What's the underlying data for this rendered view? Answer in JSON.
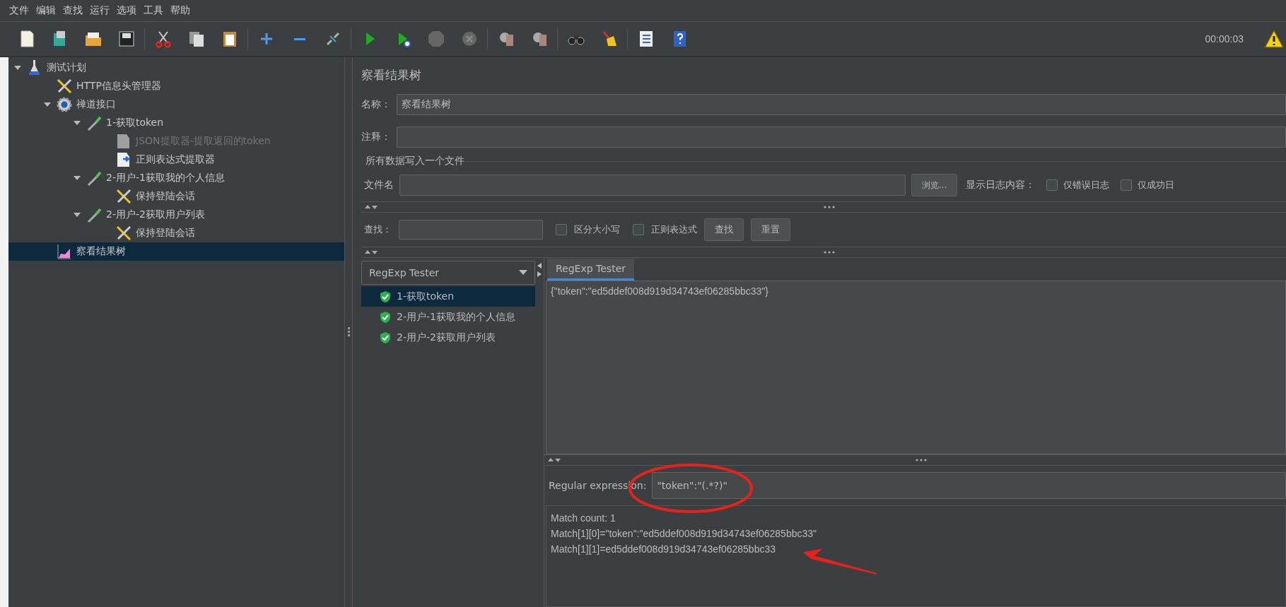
{
  "menu": [
    "文件",
    "编辑",
    "查找",
    "运行",
    "选项",
    "工具",
    "帮助"
  ],
  "toolbar": {
    "timer": "00:00:03"
  },
  "tree": [
    {
      "label": "测试计划",
      "kind": "plan",
      "expanded": true,
      "selected": false,
      "disabled": false,
      "children": [
        {
          "label": "HTTP信息头管理器",
          "kind": "config",
          "selected": false,
          "disabled": false
        },
        {
          "label": "禅道接口",
          "kind": "thread",
          "expanded": true,
          "selected": false,
          "disabled": false,
          "children": [
            {
              "label": "1-获取token",
              "kind": "sampler",
              "expanded": true,
              "selected": false,
              "disabled": false,
              "children": [
                {
                  "label": "JSON提取器-提取返回的token",
                  "kind": "extractor",
                  "selected": false,
                  "disabled": true
                },
                {
                  "label": "正则表达式提取器",
                  "kind": "extractor",
                  "selected": false,
                  "disabled": false
                }
              ]
            },
            {
              "label": "2-用户-1获取我的个人信息",
              "kind": "sampler",
              "expanded": true,
              "selected": false,
              "disabled": false,
              "children": [
                {
                  "label": "保持登陆会话",
                  "kind": "config",
                  "selected": false,
                  "disabled": false
                }
              ]
            },
            {
              "label": "2-用户-2获取用户列表",
              "kind": "sampler",
              "expanded": true,
              "selected": false,
              "disabled": false,
              "children": [
                {
                  "label": "保持登陆会话",
                  "kind": "config",
                  "selected": false,
                  "disabled": false
                }
              ]
            }
          ]
        },
        {
          "label": "察看结果树",
          "kind": "listener",
          "selected": true,
          "disabled": false
        }
      ]
    }
  ],
  "panel": {
    "title": "察看结果树",
    "name_field": {
      "label": "名称：",
      "value": "察看结果树"
    },
    "comment_field": {
      "label": "注释："
    },
    "file_section": {
      "legend": "所有数据写入一个文件",
      "file_label": "文件名",
      "browse_button": "浏览...",
      "log_label": "显示日志内容：",
      "checkboxes": [
        {
          "label": "仅错误日志",
          "checked": false
        },
        {
          "label": "仅成功日",
          "checked": false
        }
      ]
    },
    "search": {
      "label": "查找：",
      "checkboxes": [
        {
          "label": "区分大小写",
          "checked": false
        },
        {
          "label": "正则表达式",
          "checked": false
        }
      ],
      "buttons": [
        "查找",
        "重置"
      ]
    }
  },
  "results": {
    "renderer": "RegExp Tester",
    "samples": [
      {
        "label": "1-获取token",
        "selected": true
      },
      {
        "label": "2-用户-1获取我的个人信息",
        "selected": false
      },
      {
        "label": "2-用户-2获取用户列表",
        "selected": false
      }
    ],
    "tabs": [
      {
        "label": "RegExp Tester",
        "selected": true
      }
    ],
    "response": "{\"token\":\"ed5ddef008d919d34743ef06285bbc33\"}",
    "regex": {
      "label": "Regular expression:",
      "value": "\"token\":\"(.*?)\""
    },
    "output": [
      "Match count: 1",
      "Match[1][0]=\"token\":\"ed5ddef008d919d34743ef06285bbc33\"",
      "Match[1][1]=ed5ddef008d919d34743ef06285bbc33"
    ]
  }
}
